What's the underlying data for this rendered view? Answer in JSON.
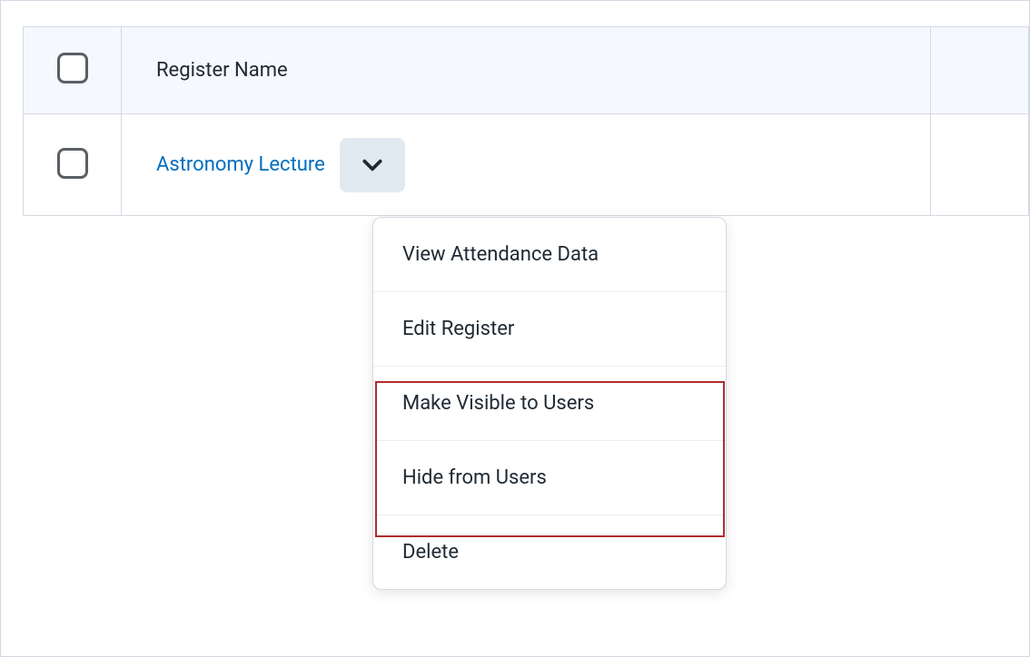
{
  "table": {
    "header": {
      "name_column": "Register Name"
    },
    "rows": [
      {
        "name": "Astronomy Lecture"
      }
    ]
  },
  "dropdown": {
    "items": [
      "View Attendance Data",
      "Edit Register",
      "Make Visible to Users",
      "Hide from Users",
      "Delete"
    ]
  }
}
